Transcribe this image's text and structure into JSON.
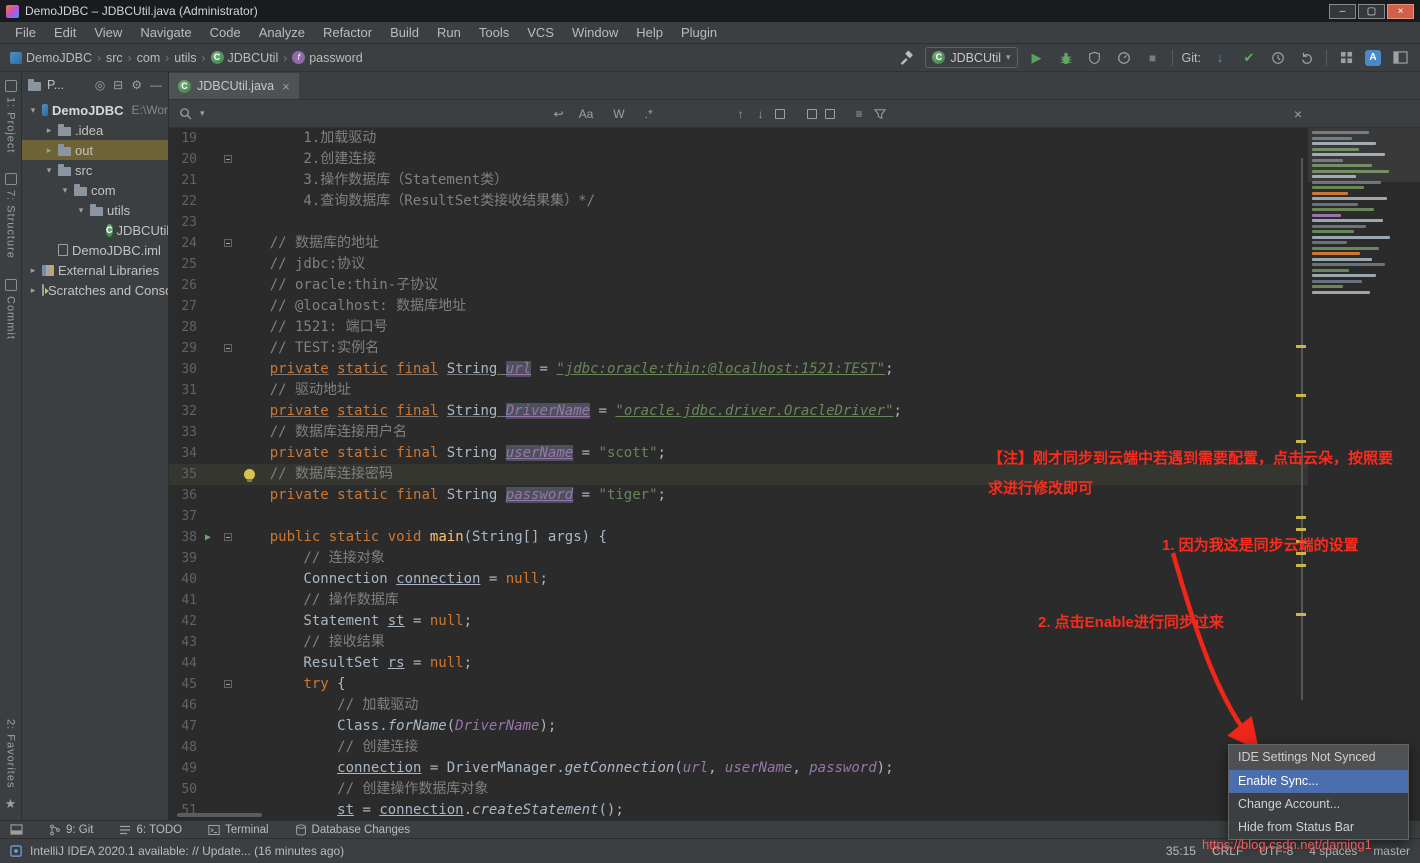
{
  "title_bar": {
    "title": "DemoJDBC – JDBCUtil.java (Administrator)"
  },
  "menu_bar": {
    "items": [
      "File",
      "Edit",
      "View",
      "Navigate",
      "Code",
      "Analyze",
      "Refactor",
      "Build",
      "Run",
      "Tools",
      "VCS",
      "Window",
      "Help",
      "Plugin"
    ]
  },
  "nav_bar": {
    "breadcrumb": [
      {
        "label": "DemoJDBC",
        "icon": "project"
      },
      {
        "label": "src"
      },
      {
        "label": "com"
      },
      {
        "label": "utils"
      },
      {
        "label": "JDBCUtil",
        "icon": "class"
      },
      {
        "label": "password",
        "icon": "field"
      }
    ],
    "run_config": "JDBCUtil",
    "git_label": "Git:"
  },
  "tool_strips": {
    "left_top": [
      "1: Project",
      "7: Structure",
      "Commit"
    ],
    "left_bottom": [
      "2: Favorites"
    ],
    "bottom": [
      {
        "icon": "git",
        "label": "9: Git"
      },
      {
        "icon": "todo",
        "label": "6: TODO"
      },
      {
        "icon": "terminal",
        "label": "Terminal"
      },
      {
        "icon": "db",
        "label": "Database Changes"
      }
    ]
  },
  "project_panel": {
    "header": "P...",
    "tree": [
      {
        "label": "DemoJDBC",
        "suffix": "E:\\Wor",
        "level": 0,
        "arrow": "exp",
        "icon": "project",
        "bold": true
      },
      {
        "label": ".idea",
        "level": 1,
        "arrow": "col",
        "icon": "folder"
      },
      {
        "label": "out",
        "level": 1,
        "arrow": "col",
        "icon": "folder",
        "selected": true
      },
      {
        "label": "src",
        "level": 1,
        "arrow": "exp",
        "icon": "folder"
      },
      {
        "label": "com",
        "level": 2,
        "arrow": "exp",
        "icon": "folder"
      },
      {
        "label": "utils",
        "level": 3,
        "arrow": "exp",
        "icon": "folder"
      },
      {
        "label": "JDBCUtil",
        "level": 4,
        "arrow": "none",
        "icon": "class"
      },
      {
        "label": "DemoJDBC.iml",
        "level": 1,
        "arrow": "none",
        "icon": "iml"
      },
      {
        "label": "External Libraries",
        "level": 0,
        "arrow": "col",
        "icon": "lib"
      },
      {
        "label": "Scratches and Consoles",
        "level": 0,
        "arrow": "col",
        "icon": "scratch"
      }
    ]
  },
  "find_bar": {
    "query": "",
    "toggles": [
      "Aa",
      "W",
      ".*"
    ]
  },
  "editor": {
    "tab": "JDBCUtil.java",
    "scroll_marks": [
      217,
      266,
      312,
      388,
      400,
      412,
      424,
      436,
      485
    ],
    "lines": [
      {
        "n": 19,
        "seg": [
          [
            "        1.加载驱动",
            "c"
          ]
        ]
      },
      {
        "n": 20,
        "seg": [
          [
            "        2.创建连接",
            "c"
          ]
        ],
        "fold": true
      },
      {
        "n": 21,
        "seg": [
          [
            "        3.操作数据库（Statement类）",
            "c"
          ]
        ]
      },
      {
        "n": 22,
        "seg": [
          [
            "        4.查询数据库（ResultSet类接收结果集）*/",
            "c"
          ]
        ]
      },
      {
        "n": 23,
        "seg": []
      },
      {
        "n": 24,
        "seg": [
          [
            "    // 数据库的地址",
            "c"
          ]
        ],
        "fold": true
      },
      {
        "n": 25,
        "seg": [
          [
            "    // jdbc:协议",
            "c"
          ]
        ]
      },
      {
        "n": 26,
        "seg": [
          [
            "    // oracle:thin-子协议",
            "c"
          ]
        ]
      },
      {
        "n": 27,
        "seg": [
          [
            "    // @localhost: 数据库地址",
            "c"
          ]
        ]
      },
      {
        "n": 28,
        "seg": [
          [
            "    // 1521: 端口号",
            "c"
          ]
        ]
      },
      {
        "n": 29,
        "seg": [
          [
            "    // TEST:实例名",
            "c"
          ]
        ],
        "fold": true
      },
      {
        "n": 30,
        "seg": [
          [
            "    ",
            "p"
          ],
          [
            "private",
            "ku"
          ],
          [
            " ",
            "p"
          ],
          [
            "static",
            "ku"
          ],
          [
            " ",
            "p"
          ],
          [
            "final",
            "ku"
          ],
          [
            " ",
            "p"
          ],
          [
            "String ",
            "pu"
          ],
          [
            "url",
            "fh"
          ],
          [
            " = ",
            "p"
          ],
          [
            "\"jdbc:oracle:thin:@localhost:1521:TEST\"",
            "su"
          ],
          [
            ";",
            "p"
          ]
        ]
      },
      {
        "n": 31,
        "seg": [
          [
            "    // 驱动地址",
            "c"
          ]
        ]
      },
      {
        "n": 32,
        "seg": [
          [
            "    ",
            "p"
          ],
          [
            "private",
            "ku"
          ],
          [
            " ",
            "p"
          ],
          [
            "static",
            "ku"
          ],
          [
            " ",
            "p"
          ],
          [
            "final",
            "ku"
          ],
          [
            " ",
            "p"
          ],
          [
            "String ",
            "pu"
          ],
          [
            "DriverName",
            "fh"
          ],
          [
            " = ",
            "p"
          ],
          [
            "\"oracle.jdbc.driver.OracleDriver\"",
            "su"
          ],
          [
            ";",
            "p"
          ]
        ]
      },
      {
        "n": 33,
        "seg": [
          [
            "    // 数据库连接用户名",
            "c"
          ]
        ]
      },
      {
        "n": 34,
        "seg": [
          [
            "    ",
            "p"
          ],
          [
            "private",
            "k"
          ],
          [
            " ",
            "p"
          ],
          [
            "static",
            "k"
          ],
          [
            " ",
            "p"
          ],
          [
            "final",
            "k"
          ],
          [
            " String ",
            "p"
          ],
          [
            "userName",
            "fh"
          ],
          [
            " = ",
            "p"
          ],
          [
            "\"scott\"",
            "s"
          ],
          [
            ";",
            "p"
          ]
        ]
      },
      {
        "n": 35,
        "seg": [
          [
            "    // 数据库连接密码",
            "c"
          ]
        ],
        "cur": true,
        "bulb": true
      },
      {
        "n": 36,
        "seg": [
          [
            "    ",
            "p"
          ],
          [
            "private",
            "k"
          ],
          [
            " ",
            "p"
          ],
          [
            "static",
            "k"
          ],
          [
            " ",
            "p"
          ],
          [
            "final",
            "k"
          ],
          [
            " String ",
            "p"
          ],
          [
            "password",
            "fh"
          ],
          [
            " = ",
            "p"
          ],
          [
            "\"tiger\"",
            "s"
          ],
          [
            ";",
            "p"
          ]
        ]
      },
      {
        "n": 37,
        "seg": []
      },
      {
        "n": 38,
        "seg": [
          [
            "    ",
            "p"
          ],
          [
            "public",
            "k"
          ],
          [
            " ",
            "p"
          ],
          [
            "static",
            "k"
          ],
          [
            " ",
            "p"
          ],
          [
            "void",
            "k"
          ],
          [
            " ",
            "p"
          ],
          [
            "main",
            "d"
          ],
          [
            "(String[] args) {",
            "p"
          ]
        ],
        "run": true,
        "fold": true
      },
      {
        "n": 39,
        "seg": [
          [
            "        // 连接对象",
            "c"
          ]
        ]
      },
      {
        "n": 40,
        "seg": [
          [
            "        Connection ",
            "p"
          ],
          [
            "connection",
            "lu"
          ],
          [
            " = ",
            "p"
          ],
          [
            "null",
            "k"
          ],
          [
            ";",
            "p"
          ]
        ]
      },
      {
        "n": 41,
        "seg": [
          [
            "        // 操作数据库",
            "c"
          ]
        ]
      },
      {
        "n": 42,
        "seg": [
          [
            "        Statement ",
            "p"
          ],
          [
            "st",
            "lu"
          ],
          [
            " = ",
            "p"
          ],
          [
            "null",
            "k"
          ],
          [
            ";",
            "p"
          ]
        ]
      },
      {
        "n": 43,
        "seg": [
          [
            "        // 接收结果",
            "c"
          ]
        ]
      },
      {
        "n": 44,
        "seg": [
          [
            "        ResultSet ",
            "p"
          ],
          [
            "rs",
            "lu"
          ],
          [
            " = ",
            "p"
          ],
          [
            "null",
            "k"
          ],
          [
            ";",
            "p"
          ]
        ]
      },
      {
        "n": 45,
        "seg": [
          [
            "        ",
            "p"
          ],
          [
            "try",
            "k"
          ],
          [
            " {",
            "p"
          ]
        ],
        "fold": true
      },
      {
        "n": 46,
        "seg": [
          [
            "            // 加载驱动",
            "c"
          ]
        ]
      },
      {
        "n": 47,
        "seg": [
          [
            "            Class.",
            "p"
          ],
          [
            "forName",
            "m"
          ],
          [
            "(",
            "p"
          ],
          [
            "DriverName",
            "f"
          ],
          [
            ");",
            "p"
          ]
        ]
      },
      {
        "n": 48,
        "seg": [
          [
            "            // 创建连接",
            "c"
          ]
        ]
      },
      {
        "n": 49,
        "seg": [
          [
            "            ",
            "p"
          ],
          [
            "connection",
            "lu"
          ],
          [
            " = DriverManager.",
            "p"
          ],
          [
            "getConnection",
            "m"
          ],
          [
            "(",
            "p"
          ],
          [
            "url",
            "f"
          ],
          [
            ", ",
            "p"
          ],
          [
            "userName",
            "f"
          ],
          [
            ", ",
            "p"
          ],
          [
            "password",
            "f"
          ],
          [
            ");",
            "p"
          ]
        ]
      },
      {
        "n": 50,
        "seg": [
          [
            "            // 创建操作数据库对象",
            "c"
          ]
        ]
      },
      {
        "n": 51,
        "seg": [
          [
            "            ",
            "p"
          ],
          [
            "st",
            "lu"
          ],
          [
            " = ",
            "p"
          ],
          [
            "connection",
            "lu"
          ],
          [
            ".",
            "p"
          ],
          [
            "createStatement",
            "m"
          ],
          [
            "();",
            "p"
          ]
        ]
      }
    ]
  },
  "minimap": {
    "rows": [
      [
        55,
        "c"
      ],
      [
        38,
        "c"
      ],
      [
        62,
        "w"
      ],
      [
        45,
        "g"
      ],
      [
        70,
        "w"
      ],
      [
        30,
        "c"
      ],
      [
        58,
        "g"
      ],
      [
        74,
        "g"
      ],
      [
        42,
        "w"
      ],
      [
        66,
        "c"
      ],
      [
        50,
        "g"
      ],
      [
        35,
        "o"
      ],
      [
        72,
        "w"
      ],
      [
        44,
        "c"
      ],
      [
        60,
        "g"
      ],
      [
        28,
        "p"
      ],
      [
        68,
        "w"
      ],
      [
        52,
        "c"
      ],
      [
        40,
        "g"
      ],
      [
        75,
        "w"
      ],
      [
        34,
        "c"
      ],
      [
        64,
        "g"
      ],
      [
        46,
        "o"
      ],
      [
        58,
        "w"
      ],
      [
        70,
        "c"
      ],
      [
        36,
        "g"
      ],
      [
        62,
        "w"
      ],
      [
        48,
        "c"
      ],
      [
        30,
        "g"
      ],
      [
        56,
        "w"
      ]
    ]
  },
  "annotations": {
    "note1_line1": "【注】刚才同步到云端中若遇到需要配置，点击云朵，按照要",
    "note1_line2": "求进行修改即可",
    "note2": "1. 因为我这是同步云端的设置",
    "note3": "2. 点击Enable进行同步过来"
  },
  "popup": {
    "title": "IDE Settings Not Synced",
    "items": [
      {
        "label": "Enable Sync...",
        "selected": true
      },
      {
        "label": "Change Account...",
        "selected": false
      },
      {
        "label": "Hide from Status Bar",
        "selected": false
      }
    ]
  },
  "status_bar": {
    "message": "IntelliJ IDEA 2020.1 available: // Update... (16 minutes ago)",
    "right_items": [
      "35:15",
      "CRLF",
      "UTF-8",
      "4 spaces",
      "master"
    ]
  },
  "watermark": "https://blog.csdn.net/daming1",
  "colors": {
    "annotation_red": "#fb2b1d",
    "selection_blue": "#4b6eaf",
    "tree_selection": "#6e6237",
    "editor_bg": "#2b2b2b"
  }
}
